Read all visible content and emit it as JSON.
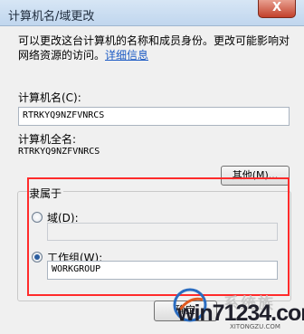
{
  "window": {
    "title": "计算机名/域更改",
    "close_glyph": "X"
  },
  "description": {
    "text": "可以更改这台计算机的名称和成员身份。更改可能影响对网络资源的访问。",
    "link": "详细信息"
  },
  "computer_name": {
    "label": "计算机名(C):",
    "value": "RTRKYQ9NZFVNRCS"
  },
  "full_name": {
    "label": "计算机全名:",
    "value": "RTRKYQ9NZFVNRCS"
  },
  "other_button": "其他(M)...",
  "member_of": {
    "legend": "隶属于",
    "domain": {
      "label": "域(D):",
      "checked": false,
      "value": ""
    },
    "workgroup": {
      "label": "工作组(W):",
      "checked": true,
      "value": "WORKGROUP"
    }
  },
  "ok_button": "确定",
  "watermark": {
    "text": "win71234.com",
    "cn": "系统族",
    "url": "XITONGZU.COM"
  }
}
